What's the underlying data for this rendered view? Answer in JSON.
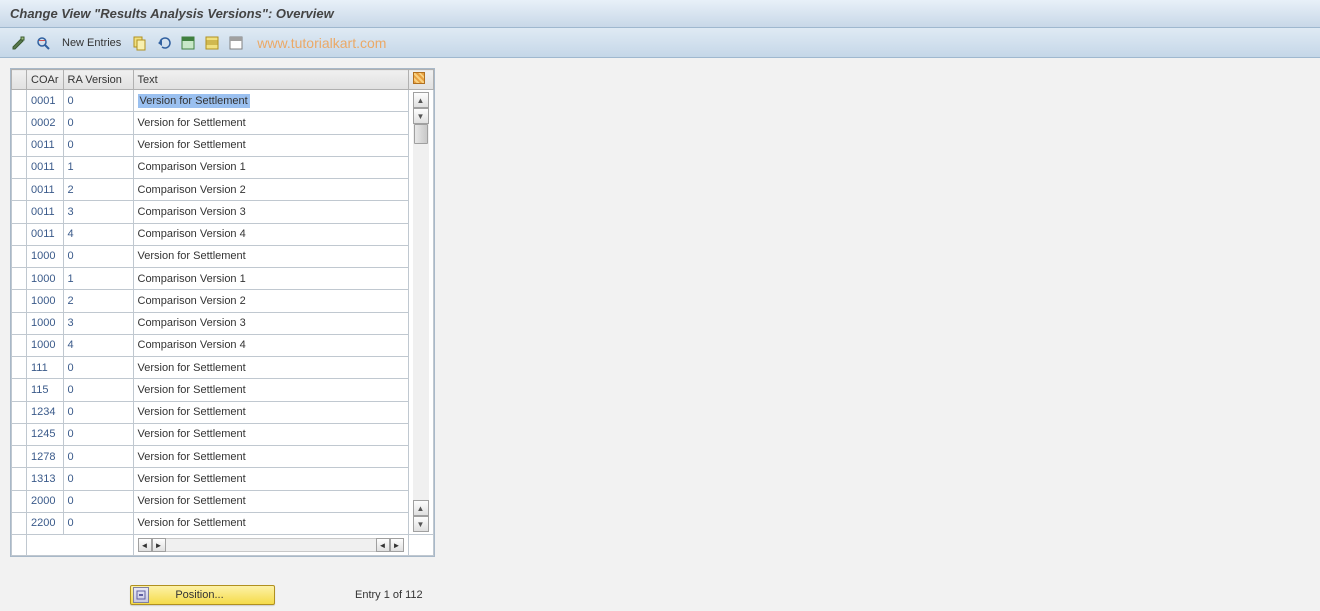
{
  "title": "Change View \"Results Analysis Versions\": Overview",
  "toolbar": {
    "new_entries_label": "New Entries"
  },
  "watermark": "www.tutorialkart.com",
  "columns": {
    "coar": "COAr",
    "ra_version": "RA Version",
    "text": "Text"
  },
  "rows": [
    {
      "coar": "0001",
      "ra": "0",
      "text": "Version for Settlement"
    },
    {
      "coar": "0002",
      "ra": "0",
      "text": "Version for Settlement"
    },
    {
      "coar": "0011",
      "ra": "0",
      "text": "Version for Settlement"
    },
    {
      "coar": "0011",
      "ra": "1",
      "text": "Comparison Version 1"
    },
    {
      "coar": "0011",
      "ra": "2",
      "text": "Comparison Version 2"
    },
    {
      "coar": "0011",
      "ra": "3",
      "text": "Comparison Version 3"
    },
    {
      "coar": "0011",
      "ra": "4",
      "text": "Comparison Version 4"
    },
    {
      "coar": "1000",
      "ra": "0",
      "text": "Version for Settlement"
    },
    {
      "coar": "1000",
      "ra": "1",
      "text": "Comparison Version 1"
    },
    {
      "coar": "1000",
      "ra": "2",
      "text": "Comparison Version 2"
    },
    {
      "coar": "1000",
      "ra": "3",
      "text": "Comparison Version 3"
    },
    {
      "coar": "1000",
      "ra": "4",
      "text": "Comparison Version 4"
    },
    {
      "coar": "111",
      "ra": "0",
      "text": "Version for Settlement"
    },
    {
      "coar": "115",
      "ra": "0",
      "text": "Version for Settlement"
    },
    {
      "coar": "1234",
      "ra": "0",
      "text": "Version for Settlement"
    },
    {
      "coar": "1245",
      "ra": "0",
      "text": "Version for Settlement"
    },
    {
      "coar": "1278",
      "ra": "0",
      "text": "Version for Settlement"
    },
    {
      "coar": "1313",
      "ra": "0",
      "text": "Version for Settlement"
    },
    {
      "coar": "2000",
      "ra": "0",
      "text": "Version for Settlement"
    },
    {
      "coar": "2200",
      "ra": "0",
      "text": "Version for Settlement"
    }
  ],
  "footer": {
    "position_label": "Position...",
    "entry_label": "Entry 1 of 112"
  }
}
